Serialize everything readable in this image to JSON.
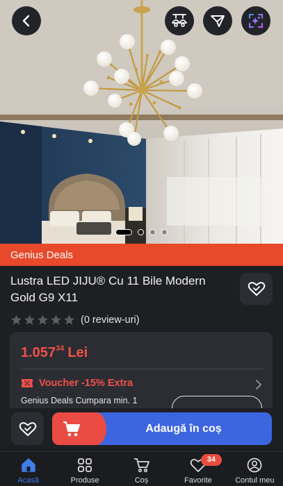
{
  "header": {
    "back_icon": "chevron-left-icon",
    "similar_icon": "lamp-compare-icon",
    "filter_icon": "send-icon",
    "ai_icon": "ai-sparkle-icon"
  },
  "gallery": {
    "image_count": 4,
    "active_index": 0
  },
  "deal_banner": {
    "label": "Genius Deals",
    "color": "#e8492a"
  },
  "product": {
    "title": "Lustra LED JIJU® Cu 11 Bile Modern Gold G9 X11",
    "rating": 0,
    "review_text": "(0 review-uri)"
  },
  "price_card": {
    "price_main": "1.057",
    "price_decimals": "34",
    "currency": "Lei",
    "price_color": "#f0504a",
    "voucher_label": "Voucher -15% Extra",
    "voucher_detail": "Genius Deals Cumpara min. 1"
  },
  "actions": {
    "add_to_cart_label": "Adaugă în coș",
    "accent": "#3c65e0"
  },
  "nav": {
    "items": [
      {
        "label": "Acasă",
        "icon": "home-icon",
        "active": true
      },
      {
        "label": "Produse",
        "icon": "grid-icon"
      },
      {
        "label": "Coș",
        "icon": "cart-icon"
      },
      {
        "label": "Favorite",
        "icon": "heart-icon",
        "badge": "34"
      },
      {
        "label": "Contul meu",
        "icon": "user-icon"
      }
    ]
  }
}
